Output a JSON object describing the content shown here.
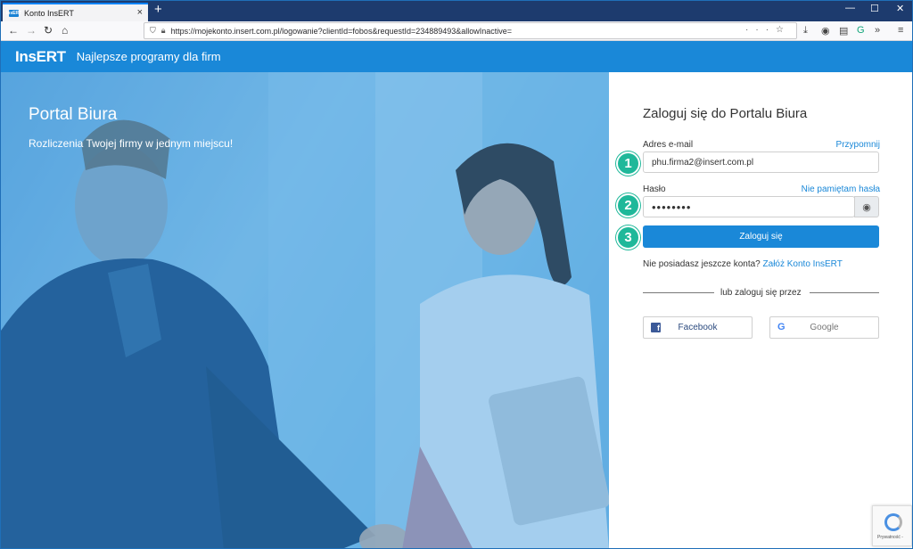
{
  "browser": {
    "tab_title": "Konto InsERT",
    "tab_favicon": "InsERT",
    "url": "https://mojekonto.insert.com.pl/logowanie?clientId=fobos&requestId=234889493&allowInactive="
  },
  "header": {
    "logo": "InsERT",
    "tagline": "Najlepsze programy dla firm"
  },
  "hero": {
    "title": "Portal Biura",
    "subtitle": "Rozliczenia Twojej firmy w jednym miejscu!"
  },
  "login": {
    "title": "Zaloguj się do Portalu Biura",
    "email_label": "Adres e-mail",
    "email_remind_link": "Przypomnij",
    "email_value": "phu.firma2@insert.com.pl",
    "password_label": "Hasło",
    "password_forgot_link": "Nie pamiętam hasła",
    "password_value": "••••••••",
    "submit_label": "Zaloguj się",
    "no_account_text": "Nie posiadasz jeszcze konta?",
    "create_account_link": "Załóż Konto InsERT",
    "divider_text": "lub zaloguj się przez",
    "facebook_label": "Facebook",
    "google_label": "Google",
    "badges": [
      "1",
      "2",
      "3"
    ]
  },
  "recaptcha": {
    "label": "Prywatność -"
  },
  "colors": {
    "brand_blue": "#1a88d8",
    "badge_green": "#1fb89a",
    "tabbar": "#1d3b6e"
  }
}
